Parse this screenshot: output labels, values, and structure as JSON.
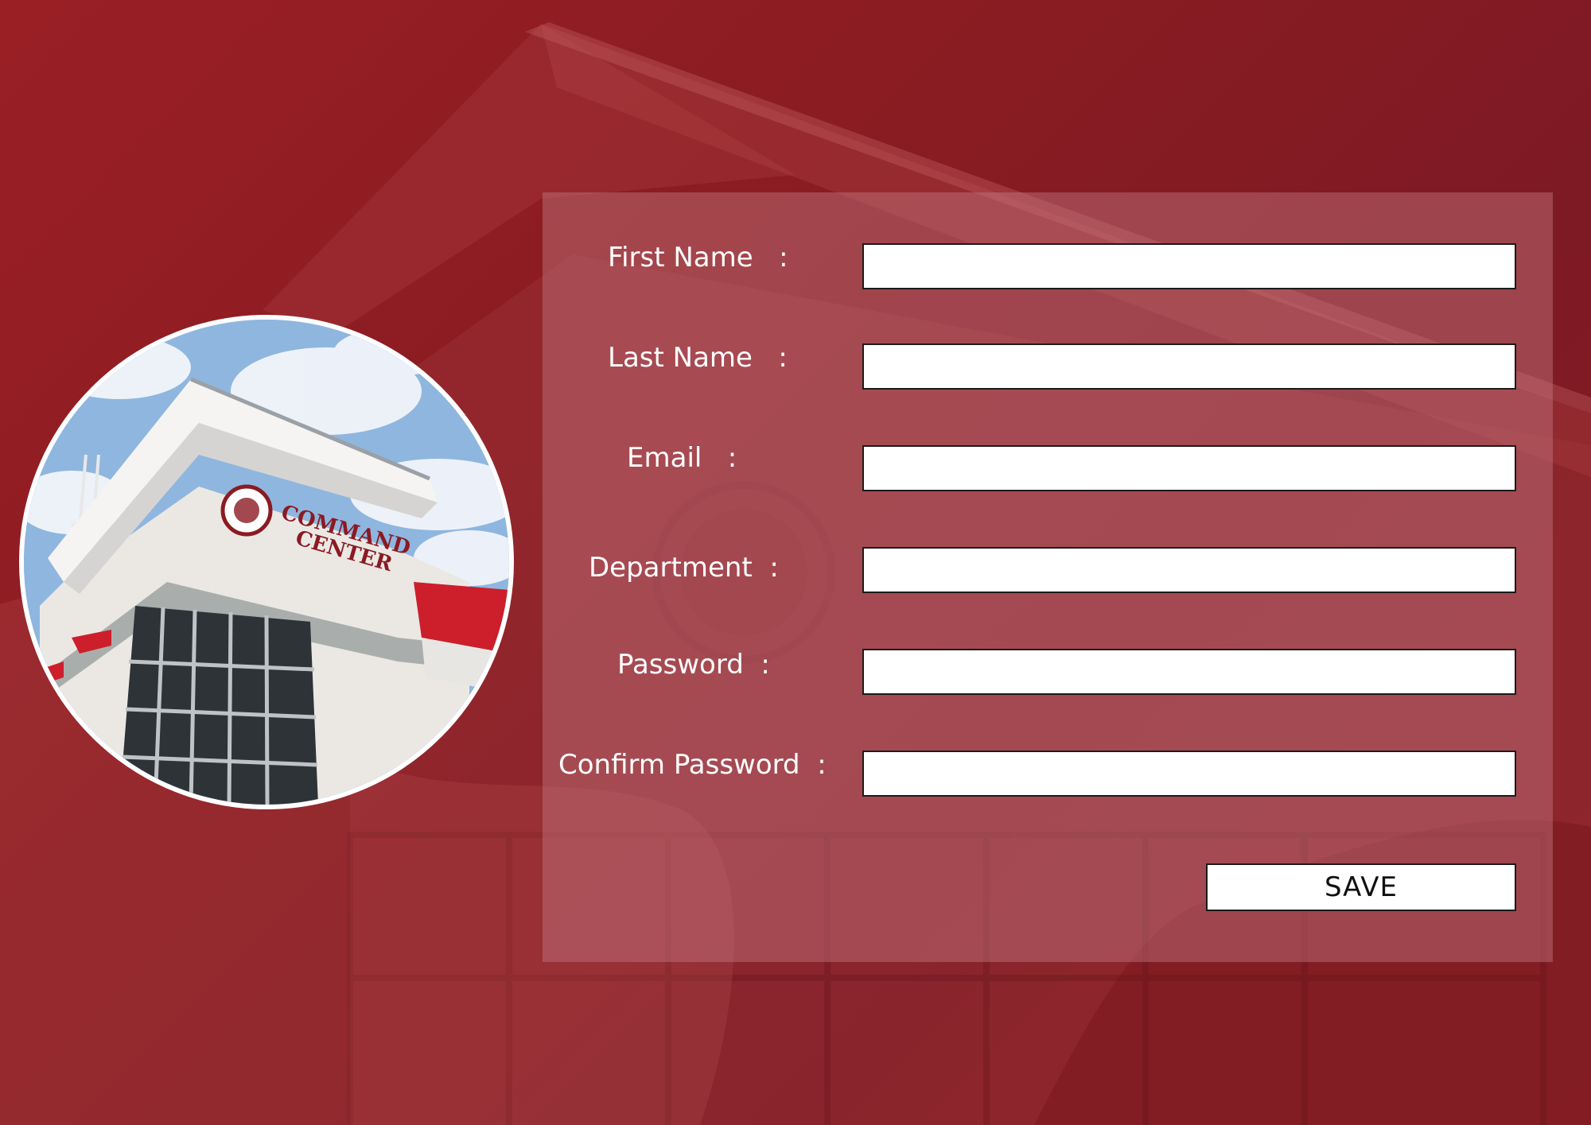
{
  "form": {
    "first_name": {
      "label": "First Name   :",
      "value": ""
    },
    "last_name": {
      "label": "Last Name   :",
      "value": ""
    },
    "email": {
      "label": "Email   :",
      "value": ""
    },
    "department": {
      "label": "Department  :",
      "value": ""
    },
    "password": {
      "label": "Password  :",
      "value": ""
    },
    "confirm_password": {
      "label": "Confirm Password  :",
      "value": ""
    },
    "save_label": "SAVE"
  },
  "photo": {
    "sign_line1": "COMMAND",
    "sign_line2": "CENTER"
  },
  "colors": {
    "background": "#8e1d22",
    "panel": "#c47880",
    "input_bg": "#ffffff",
    "input_border": "#1b1b1b",
    "label_text": "#ffffff",
    "sign_text": "#8b1a22"
  }
}
